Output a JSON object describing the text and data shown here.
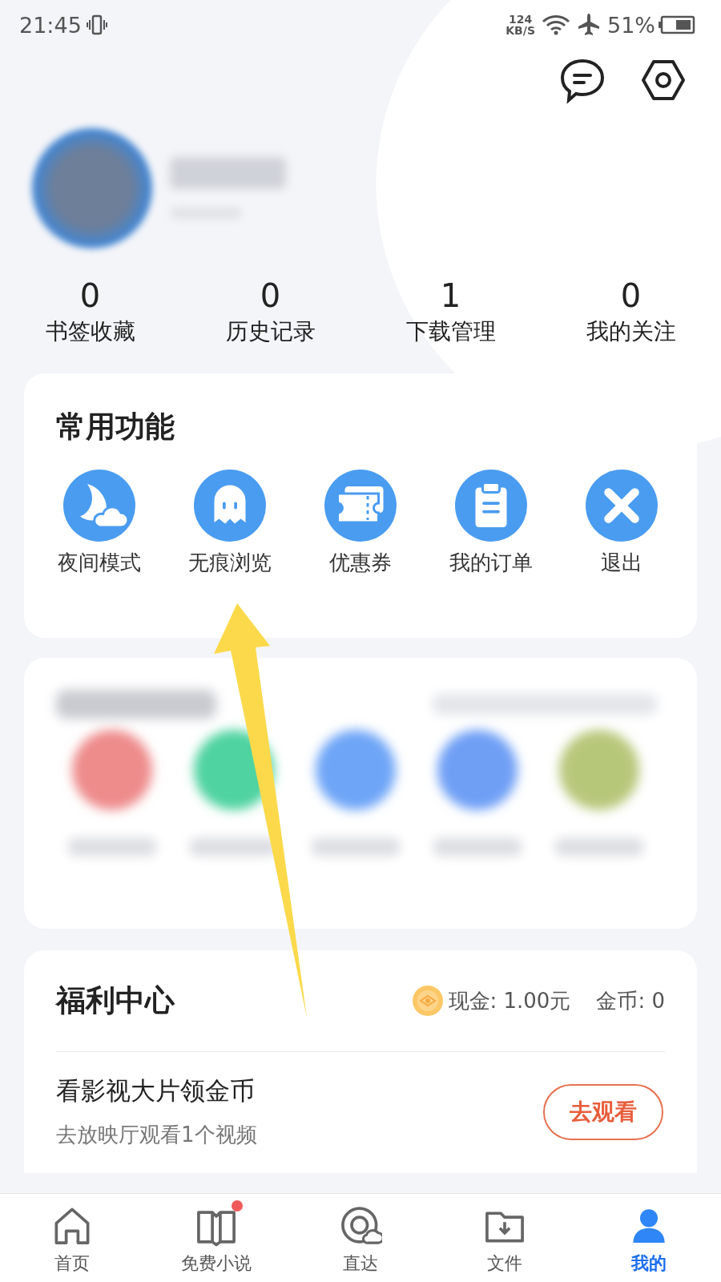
{
  "status_bar": {
    "time": "21:45",
    "net_speed": "124",
    "net_unit": "KB/S",
    "battery": "51%"
  },
  "stats": [
    {
      "value": "0",
      "label": "书签收藏"
    },
    {
      "value": "0",
      "label": "历史记录"
    },
    {
      "value": "1",
      "label": "下载管理"
    },
    {
      "value": "0",
      "label": "我的关注"
    }
  ],
  "common_functions": {
    "title": "常用功能",
    "items": [
      {
        "label": "夜间模式",
        "kind": "moon"
      },
      {
        "label": "无痕浏览",
        "kind": "ghost"
      },
      {
        "label": "优惠券",
        "kind": "ticket"
      },
      {
        "label": "我的订单",
        "kind": "clipboard"
      },
      {
        "label": "退出",
        "kind": "close"
      }
    ]
  },
  "welfare": {
    "title": "福利中心",
    "cash": "现金: 1.00元",
    "coins": "金币: 0",
    "task": {
      "title": "看影视大片领金币",
      "subtitle": "去放映厅观看1个视频",
      "button": "去观看"
    }
  },
  "tabs": [
    {
      "label": "首页",
      "kind": "home",
      "selected": false,
      "badge": false
    },
    {
      "label": "免费小说",
      "kind": "book",
      "selected": false,
      "badge": true
    },
    {
      "label": "直达",
      "kind": "direct",
      "selected": false,
      "badge": false
    },
    {
      "label": "文件",
      "kind": "folder",
      "selected": false,
      "badge": false
    },
    {
      "label": "我的",
      "kind": "person",
      "selected": true,
      "badge": false
    }
  ]
}
